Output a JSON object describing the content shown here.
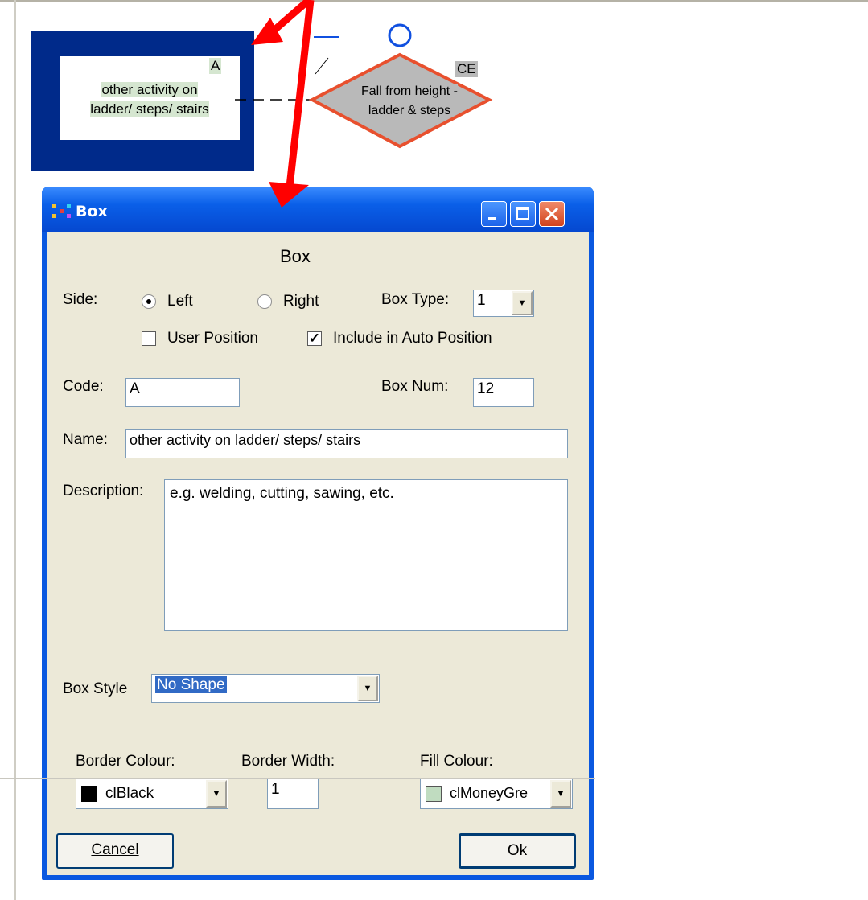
{
  "canvas": {
    "left_box": {
      "code": "A",
      "name_line1": "other activity on",
      "name_line2": "ladder/ steps/ stairs"
    },
    "right_box": {
      "code": "CE",
      "name_line1": "Fall from height -",
      "name_line2": "ladder & steps"
    }
  },
  "dialog": {
    "title": "Box",
    "heading": "Box",
    "side_label": "Side:",
    "side_options": [
      "Left",
      "Right"
    ],
    "side_selected": "Left",
    "box_type_label": "Box Type:",
    "box_type_value": "1",
    "user_position_label": "User Position",
    "user_position_checked": false,
    "include_auto_label": "Include in Auto Position",
    "include_auto_checked": true,
    "code_label": "Code:",
    "code_value": "A",
    "box_num_label": "Box Num:",
    "box_num_value": "12",
    "name_label": "Name:",
    "name_value": "other activity on ladder/ steps/ stairs",
    "description_label": "Description:",
    "description_value": "e.g. welding, cutting, sawing, etc.",
    "box_style_label": "Box Style",
    "box_style_value": "No Shape",
    "border_colour_label": "Border Colour:",
    "border_colour_value": "clBlack",
    "border_colour_swatch": "#000000",
    "border_width_label": "Border Width:",
    "border_width_value": "1",
    "fill_colour_label": "Fill Colour:",
    "fill_colour_value": "clMoneyGre",
    "fill_colour_swatch": "#c0dcc0",
    "cancel_label": "Cancel",
    "ok_label": "Ok"
  },
  "colors": {
    "selection_frame": "#002a8a",
    "label_highlight": "#d5e6d0",
    "cause_fill": "#b9b9b9",
    "cause_border": "#e8502e",
    "annotation_arrow": "#ff0000",
    "connector_circle": "#1050e0"
  },
  "icons": [
    "app-icon",
    "minimize-icon",
    "maximize-icon",
    "close-icon",
    "dropdown-arrow-icon",
    "checkmark-icon",
    "annotation-arrow"
  ]
}
